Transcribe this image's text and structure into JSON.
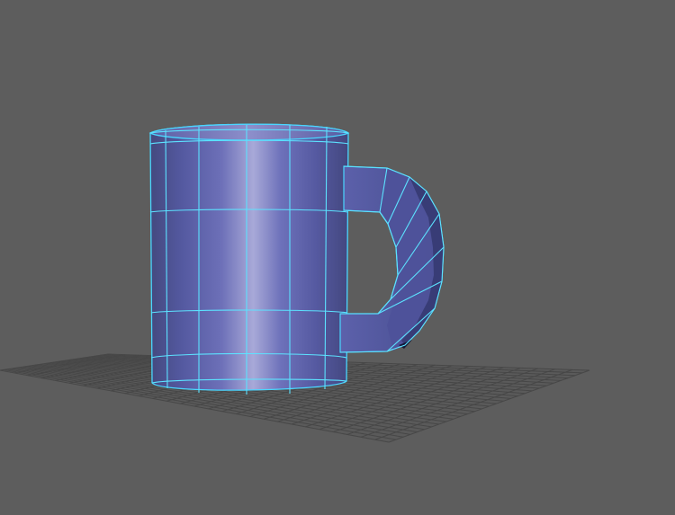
{
  "viewport": {
    "background_color": "#5d5d5d",
    "grid_color": "#474747",
    "wireframe_color": "#5ce2ff",
    "mesh_base_color": "#5b5fa4",
    "mesh_highlight_color": "#a7a8d8",
    "mesh_shadow_color": "#3f437d",
    "selected_object": "mug",
    "object_state": "selected"
  }
}
